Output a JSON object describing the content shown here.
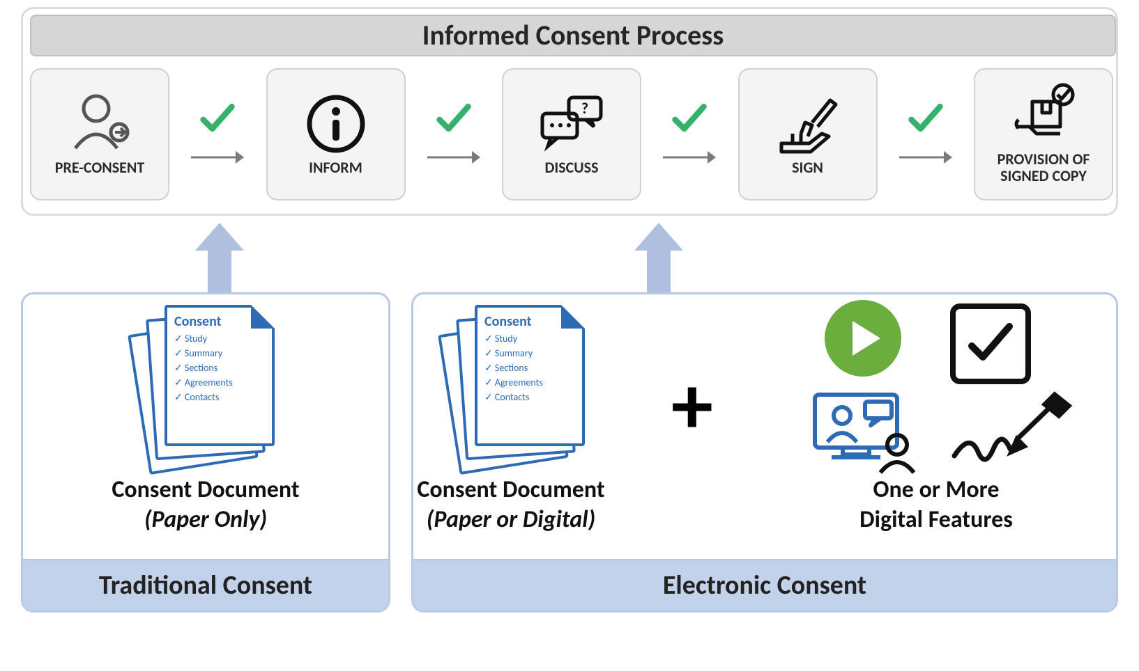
{
  "title": "Informed Consent Process",
  "steps": [
    {
      "label": "PRE-CONSENT",
      "icon": "person-arrow-icon"
    },
    {
      "label": "INFORM",
      "icon": "info-icon"
    },
    {
      "label": "DISCUSS",
      "icon": "chat-icon"
    },
    {
      "label": "SIGN",
      "icon": "hand-sign-icon"
    },
    {
      "label": "PROVISION OF SIGNED COPY",
      "icon": "package-check-icon"
    }
  ],
  "check_color": "#35b26a",
  "arrow_color": "#7a7a7a",
  "big_arrow_color": "#aebfe0",
  "document_color": "#2d6bb5",
  "consent_doc": {
    "header": "Consent",
    "items": [
      "Study",
      "Summary",
      "Sections",
      "Agreements",
      "Contacts"
    ]
  },
  "traditional": {
    "box_title": "Traditional Consent",
    "desc_line1": "Consent Document",
    "desc_line2": "(Paper Only)"
  },
  "electronic": {
    "box_title": "Electronic Consent",
    "desc_left_line1": "Consent Document",
    "desc_left_line2": "(Paper or Digital)",
    "plus": "+",
    "desc_right_line1": "One or More",
    "desc_right_line2": "Digital Features",
    "feature_icons": [
      "play-icon",
      "checkbox-icon",
      "telehealth-icon",
      "e-signature-icon"
    ]
  }
}
